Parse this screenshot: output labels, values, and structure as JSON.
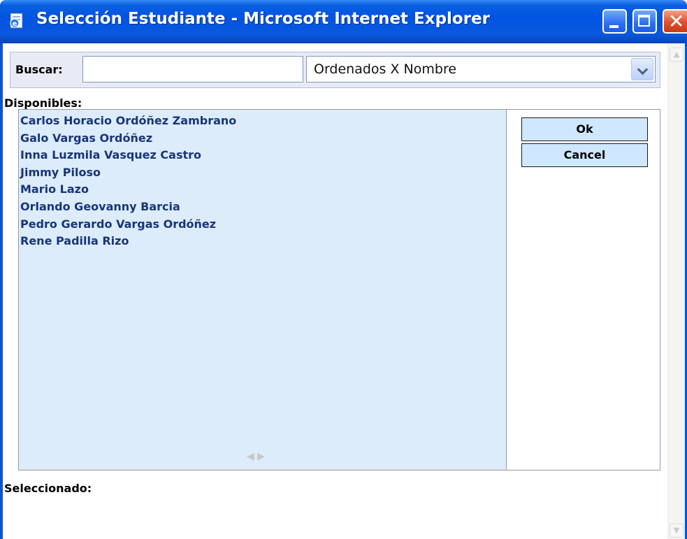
{
  "window": {
    "title": "Selección Estudiante - Microsoft Internet Explorer",
    "icon": "ie-page-icon",
    "controls": [
      "minimize-icon",
      "maximize-icon",
      "close-icon"
    ]
  },
  "search": {
    "label": "Buscar:",
    "value": "",
    "placeholder": ""
  },
  "order": {
    "selected": "Ordenados X Nombre"
  },
  "available": {
    "label": "Disponibles:",
    "items": [
      "Carlos Horacio Ordóñez Zambrano",
      "Galo Vargas Ordóñez",
      "Inna Luzmila Vasquez Castro",
      "Jimmy Piloso",
      "Mario Lazo",
      "Orlando Geovanny Barcia",
      "Pedro Gerardo Vargas Ordóñez",
      "Rene Padilla Rizo"
    ]
  },
  "buttons": {
    "ok": "Ok",
    "cancel": "Cancel"
  },
  "selected": {
    "label": "Seleccionado:"
  },
  "colors": {
    "titlebar": "#0054e3",
    "list_background": "#dcecfb",
    "list_text": "#17357a",
    "button_background": "#cfe7ff"
  }
}
